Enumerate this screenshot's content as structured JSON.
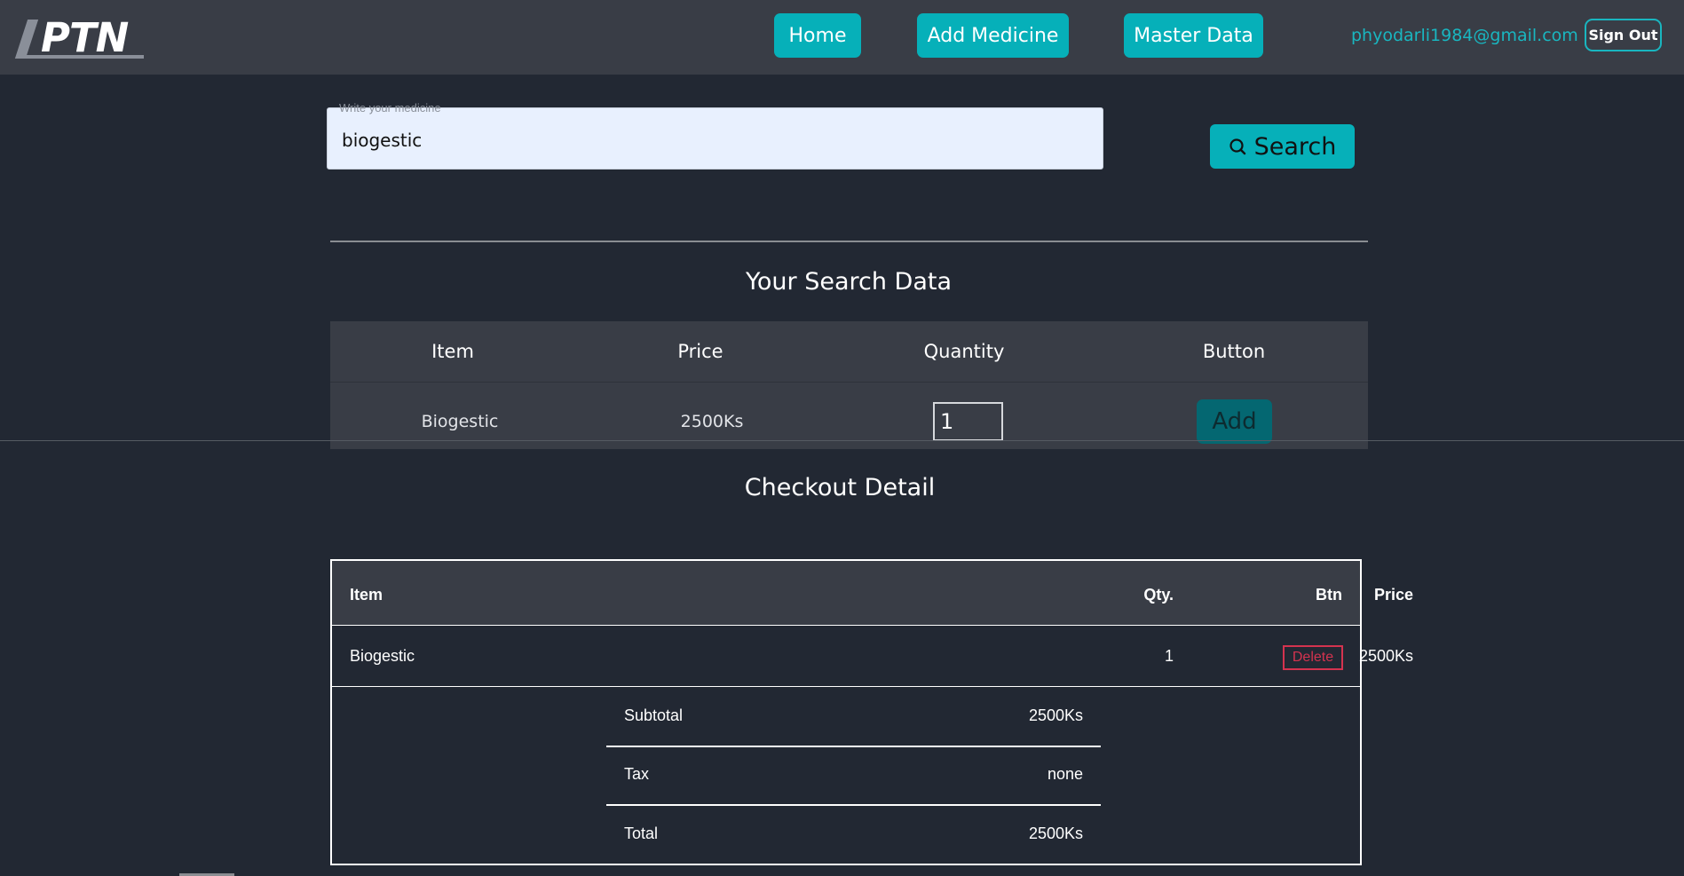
{
  "nav": {
    "logo_text": "PTN",
    "home_label": "Home",
    "add_medicine_label": "Add Medicine",
    "master_data_label": "Master Data",
    "user_email": "phyodarli1984@gmail.com",
    "sign_out_label": "Sign Out",
    "accent_color": "#06b0b9"
  },
  "search": {
    "legend": "Write your medicine",
    "value": "biogestic",
    "button_label": "Search",
    "button_icon": "search-icon"
  },
  "results": {
    "title": "Your Search Data",
    "columns": [
      "Item",
      "Price",
      "Quantity",
      "Button"
    ],
    "rows": [
      {
        "item": "Biogestic",
        "price": "2500Ks",
        "quantity": "1",
        "button_label": "Add"
      }
    ]
  },
  "checkout": {
    "title": "Checkout Detail",
    "columns": [
      "Item",
      "Qty.",
      "Price",
      "Btn"
    ],
    "rows": [
      {
        "item": "Biogestic",
        "qty": "1",
        "price": "2500Ks",
        "button_label": "Delete"
      }
    ],
    "summary": {
      "subtotal_label": "Subtotal",
      "subtotal_value": "2500Ks",
      "tax_label": "Tax",
      "tax_value": "none",
      "total_label": "Total",
      "total_value": "2500Ks"
    },
    "delete_color": "#d4334f"
  }
}
